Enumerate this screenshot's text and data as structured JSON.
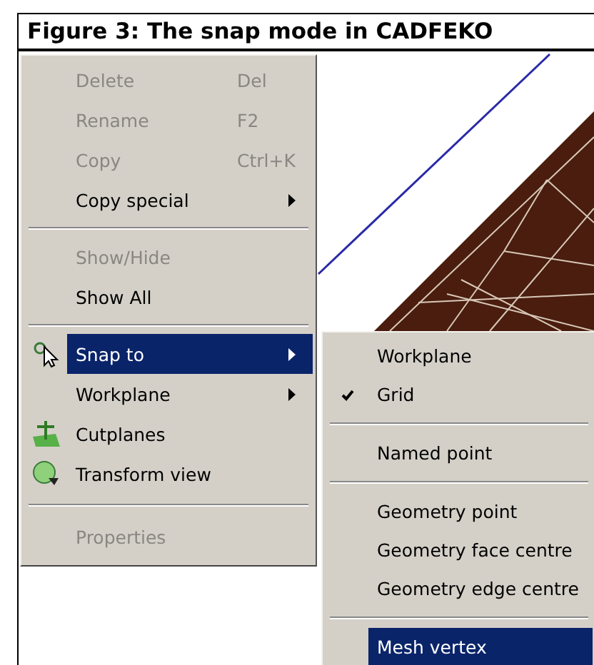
{
  "figure": {
    "title": "Figure 3: The snap mode in CADFEKO"
  },
  "menu": {
    "items": [
      {
        "kind": "item",
        "label": "Delete",
        "shortcut": "Del",
        "disabled": true,
        "selected": false,
        "has_submenu": false
      },
      {
        "kind": "item",
        "label": "Rename",
        "shortcut": "F2",
        "disabled": true,
        "selected": false,
        "has_submenu": false
      },
      {
        "kind": "item",
        "label": "Copy",
        "shortcut": "Ctrl+K",
        "disabled": true,
        "selected": false,
        "has_submenu": false
      },
      {
        "kind": "item",
        "label": "Copy special",
        "disabled": false,
        "selected": false,
        "has_submenu": true
      },
      {
        "kind": "separator"
      },
      {
        "kind": "item",
        "label": "Show/Hide",
        "disabled": true,
        "selected": false,
        "has_submenu": false
      },
      {
        "kind": "item",
        "label": "Show All",
        "disabled": false,
        "selected": false,
        "has_submenu": false
      },
      {
        "kind": "separator"
      },
      {
        "kind": "item",
        "label": "Snap to",
        "disabled": false,
        "selected": true,
        "has_submenu": true
      },
      {
        "kind": "item",
        "label": "Workplane",
        "disabled": false,
        "selected": false,
        "has_submenu": true
      },
      {
        "kind": "item",
        "label": "Cutplanes",
        "disabled": false,
        "selected": false,
        "has_submenu": false
      },
      {
        "kind": "item",
        "label": "Transform view",
        "disabled": false,
        "selected": false,
        "has_submenu": false
      },
      {
        "kind": "separator"
      },
      {
        "kind": "item",
        "label": "Properties",
        "disabled": true,
        "selected": false,
        "has_submenu": false
      }
    ]
  },
  "submenu": {
    "items": [
      {
        "kind": "item",
        "label": "Workplane",
        "checked": false,
        "selected": false
      },
      {
        "kind": "item",
        "label": "Grid",
        "checked": true,
        "selected": false
      },
      {
        "kind": "separator"
      },
      {
        "kind": "item",
        "label": "Named point",
        "checked": false,
        "selected": false
      },
      {
        "kind": "separator"
      },
      {
        "kind": "item",
        "label": "Geometry point",
        "checked": false,
        "selected": false
      },
      {
        "kind": "item",
        "label": "Geometry face centre",
        "checked": false,
        "selected": false
      },
      {
        "kind": "item",
        "label": "Geometry edge centre",
        "checked": false,
        "selected": false
      },
      {
        "kind": "separator"
      },
      {
        "kind": "item",
        "label": "Mesh vertex",
        "checked": false,
        "selected": true
      }
    ]
  }
}
